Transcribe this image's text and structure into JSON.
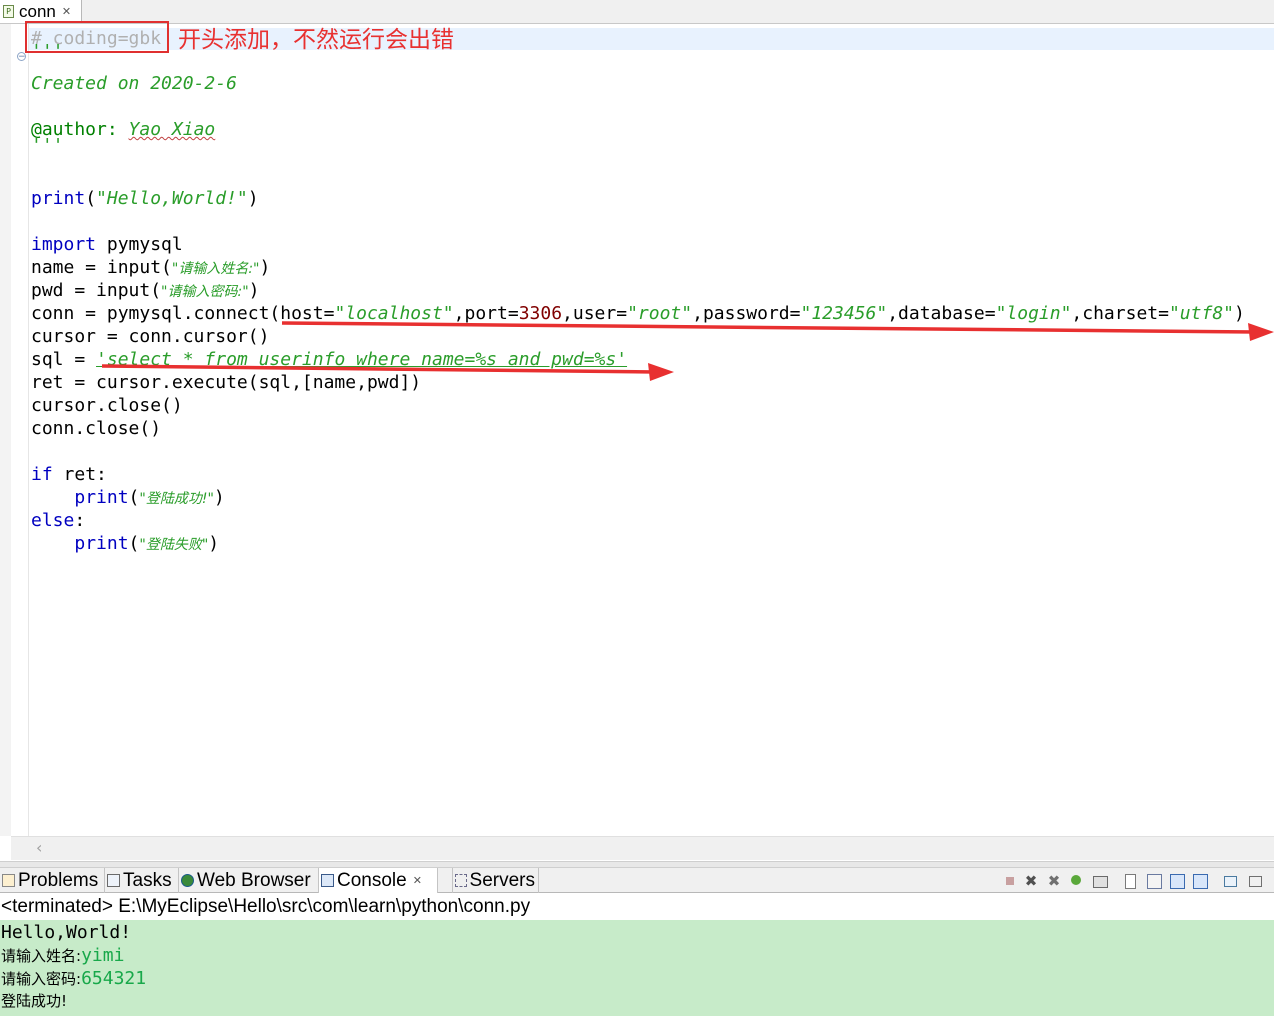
{
  "editor_tab": {
    "label": "conn",
    "icon": "python-file-icon",
    "close": "✕"
  },
  "annotation": {
    "box_text": "# coding=gbk",
    "note": "开头添加，不然运行会出错",
    "color": "#e83030"
  },
  "code": {
    "l1_comment": "# coding=gbk",
    "l2_doc_open": "'''",
    "l3_created": "Created on 2020-2-6",
    "l5_author_tag": "@author:",
    "l5_author_name": "Yao Xiao",
    "l6_doc_close": "'''",
    "print_kw": "print",
    "hello_open": "(",
    "hello_str": "\"Hello,World!\"",
    "hello_close": ")",
    "import_kw": "import",
    "import_mod": " pymysql",
    "name_lhs": "name = input(",
    "name_str": "\"请输入姓名:\"",
    "name_close": ")",
    "pwd_lhs": "pwd = input(",
    "pwd_str": "\"请输入密码:\"",
    "pwd_close": ")",
    "conn_lhs": "conn = pymysql.connect(host=",
    "conn_host": "\"localhost\"",
    "conn_port_key": ",port=",
    "conn_port": "3306",
    "conn_user_key": ",user=",
    "conn_user": "\"root\"",
    "conn_pwd_key": ",password=",
    "conn_pwd": "\"123456\"",
    "conn_db_key": ",database=",
    "conn_db": "\"login\"",
    "conn_cs_key": ",charset=",
    "conn_cs": "\"utf8\"",
    "conn_close": ")",
    "cursor_line": "cursor = conn.cursor()",
    "sql_lhs": "sql = ",
    "sql_str": "'select * from userinfo where name=%s and pwd=%s'",
    "ret_line": "ret = cursor.execute(sql,[name,pwd])",
    "cclose_line": "cursor.close()",
    "connclose_line": "conn.close()",
    "if_kw": "if",
    "if_rest": " ret:",
    "ok_indent": "    ",
    "ok_kw": "print",
    "ok_open": "(",
    "ok_str": "\"登陆成功!\"",
    "ok_close": ")",
    "else_kw": "else",
    "else_colon": ":",
    "fail_indent": "    ",
    "fail_kw": "print",
    "fail_open": "(",
    "fail_str": "\"登陆失败\"",
    "fail_close": ")"
  },
  "views": {
    "tabs": [
      {
        "label": "Problems",
        "icon": "problems-icon",
        "active": false
      },
      {
        "label": "Tasks",
        "icon": "tasks-icon",
        "active": false
      },
      {
        "label": "Web Browser",
        "icon": "globe-icon",
        "active": false
      },
      {
        "label": "Console",
        "icon": "console-icon",
        "active": true,
        "close": "✕"
      },
      {
        "label": "Servers",
        "icon": "servers-icon",
        "active": false
      }
    ]
  },
  "console": {
    "path": "<terminated> E:\\MyEclipse\\Hello\\src\\com\\learn\\python\\conn.py",
    "l1": "Hello,World!",
    "l2_prompt": "请输入姓名:",
    "l2_input": "yimi",
    "l3_prompt": "请输入密码:",
    "l3_input": "654321",
    "l4": "登陆成功!",
    "bg_color": "#c7ebc9",
    "input_color": "#18a84a"
  }
}
